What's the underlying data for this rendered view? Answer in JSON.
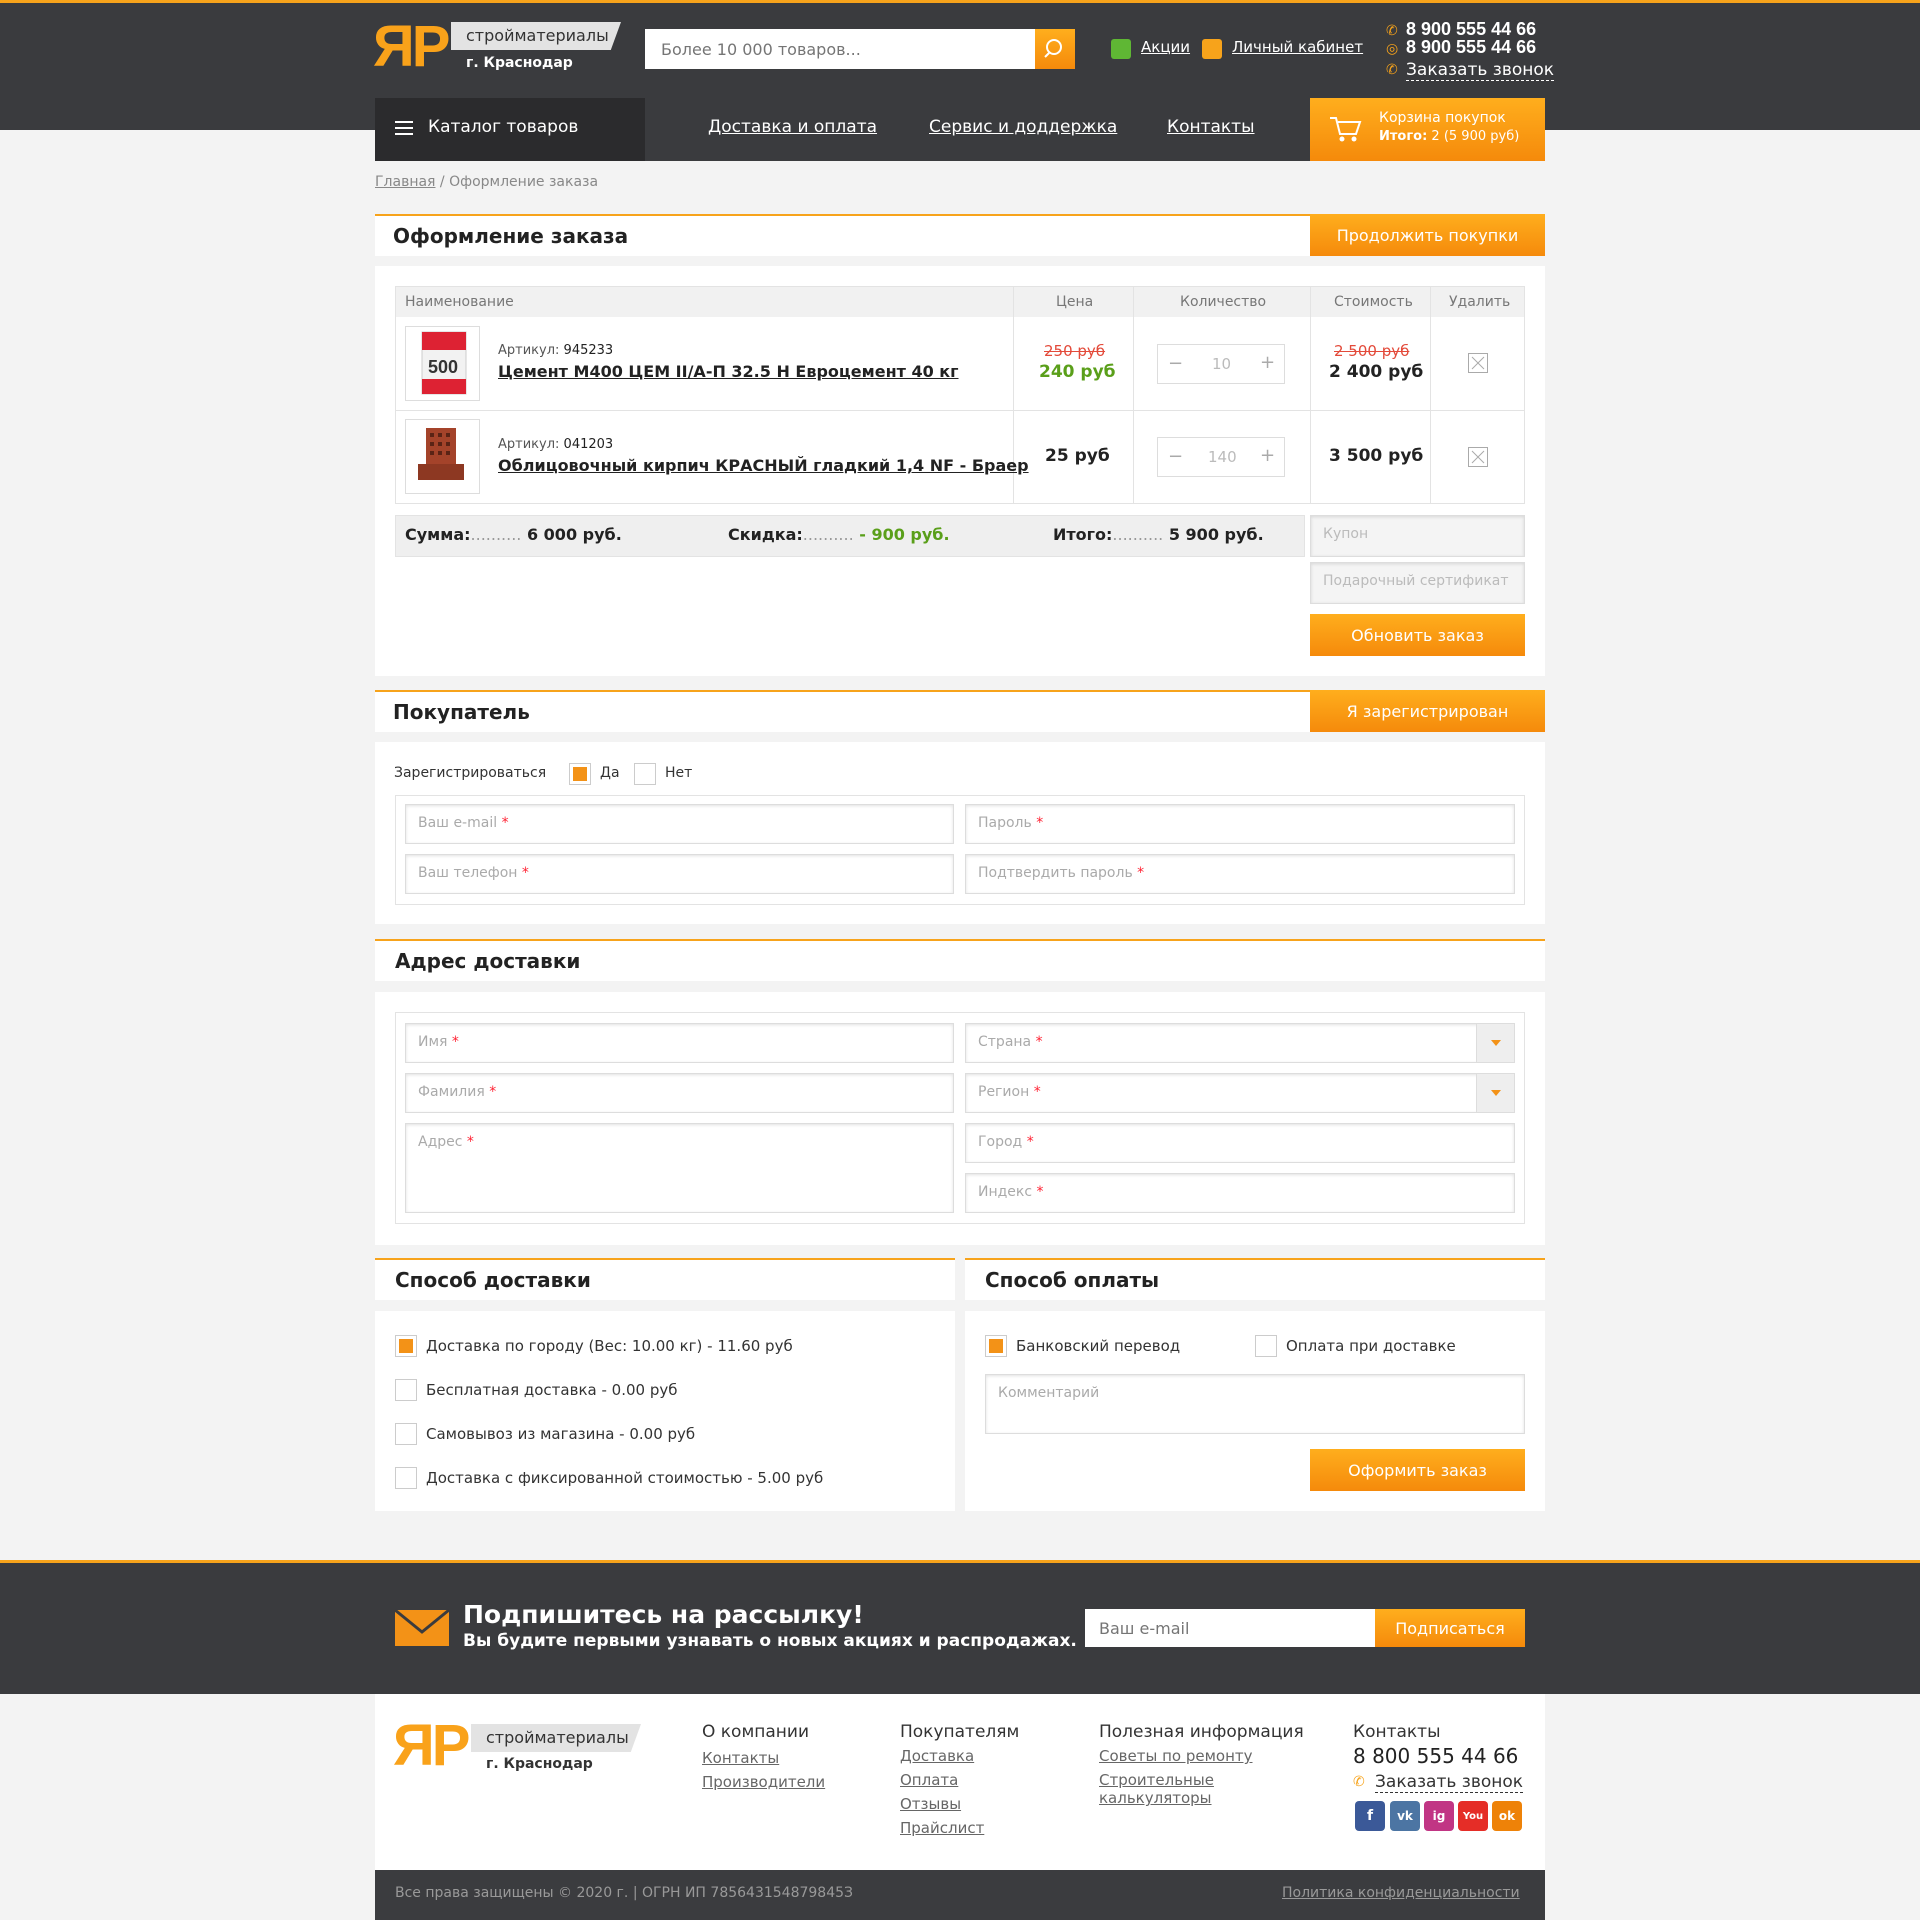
{
  "header": {
    "logo_mark": "ЯР",
    "logo_line1": "стройматериалы",
    "logo_line2": "г. Краснодар",
    "search_placeholder": "Более 10 000 товаров...",
    "promo_link": "Акции",
    "account_link": "Личный кабинет",
    "phone1": "8 900 555 44 66",
    "phone2": "8 900 555 44 66",
    "callback": "Заказать звонок"
  },
  "nav": {
    "catalog": "Каталог товаров",
    "links": [
      "Доставка и оплата",
      "Сервис и доддержка",
      "Контакты"
    ],
    "cart_title": "Корзина покупок",
    "cart_total_label": "Итого:",
    "cart_total_value": "2 (5 900 руб)"
  },
  "breadcrumb": {
    "home": "Главная",
    "sep": " / ",
    "current": "Оформление заказа"
  },
  "order": {
    "title": "Оформление заказа",
    "continue_button": "Продолжить покупки",
    "columns": [
      "Наименование",
      "Цена",
      "Количество",
      "Стоимость",
      "Удалить"
    ],
    "items": [
      {
        "sku_label": "Артикул:",
        "sku": "945233",
        "name": "Цемент М400 ЦЕМ II/А-П 32.5 Н Евроцемент 40 кг",
        "old_price": "250 руб",
        "price": "240 руб",
        "qty": "10",
        "old_total": "2 500 руб",
        "total": "2 400 руб"
      },
      {
        "sku_label": "Артикул:",
        "sku": "041203",
        "name": "Облицовочный кирпич КРАСНЫЙ гладкий 1,4 NF - Браер",
        "old_price": "",
        "price": "25 руб",
        "qty": "140",
        "old_total": "",
        "total": "3 500 руб"
      }
    ],
    "sum_label": "Сумма:",
    "sum_value": "6 000 руб.",
    "discount_label": "Скидка:",
    "discount_value": "- 900 руб.",
    "total_label": "Итого:",
    "total_value": "5 900 руб.",
    "dots": "..........",
    "coupon_placeholder": "Купон",
    "gift_placeholder": "Подарочный сертификат",
    "update_button": "Обновить заказ"
  },
  "buyer": {
    "title": "Покупатель",
    "registered_button": "Я зарегистрирован",
    "register_label": "Зарегистрироваться",
    "yes": "Да",
    "no": "Нет",
    "email": "Ваш e-mail",
    "password": "Пароль",
    "phone": "Ваш телефон",
    "confirm": "Подтвердить пароль",
    "star": "*"
  },
  "address": {
    "title": "Адрес доставки",
    "name": "Имя",
    "surname": "Фамилия",
    "address": "Адрес",
    "country": "Страна",
    "region": "Регион",
    "city": "Город",
    "zip": "Индекс",
    "star": "*"
  },
  "delivery": {
    "title": "Способ доставки",
    "options": [
      "Доставка по городу (Вес: 10.00 кг) - 11.60 руб",
      "Бесплатная доставка - 0.00 руб",
      "Самовывоз из магазина - 0.00 руб",
      "Доставка с фиксированной стоимостью - 5.00 руб"
    ]
  },
  "payment": {
    "title": "Способ оплаты",
    "options": [
      "Банковский перевод",
      "Оплата при доставке"
    ],
    "comment_placeholder": "Комментарий",
    "submit_button": "Оформить заказ"
  },
  "subscribe": {
    "title": "Подпишитесь на рассылку!",
    "subtitle": "Вы будите первыми узнавать о новых акциях и распродажах.",
    "email_placeholder": "Ваш e-mail",
    "button": "Подписаться"
  },
  "footer": {
    "col1_title": "О компании",
    "col1": [
      "Контакты",
      "Производители"
    ],
    "col2_title": "Покупателям",
    "col2": [
      "Доставка",
      "Оплата",
      "Отзывы",
      "Прайслист"
    ],
    "col3_title": "Полезная информация",
    "col3": [
      "Советы по ремонту",
      "Строительные калькуляторы"
    ],
    "col4_title": "Контакты",
    "phone": "8 800 555 44 66",
    "callback": "Заказать звонок",
    "social": [
      "f",
      "vk",
      "ig",
      "You",
      "ok"
    ],
    "copyright": "Все права защищены © 2020 г. | ОГРН ИП 785643154879845З",
    "privacy": "Политика конфиденциальности"
  },
  "colors": {
    "accent": "#f7a31b",
    "dark": "#3a3b3e",
    "green": "#5a9f1a",
    "red": "#e34a3a"
  }
}
